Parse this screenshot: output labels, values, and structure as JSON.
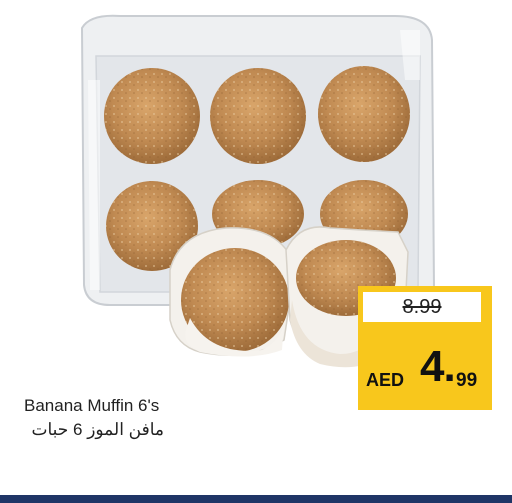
{
  "product": {
    "name_en": "Banana Muffin 6's",
    "name_ar": "مافن الموز 6 حبات"
  },
  "price": {
    "old": "8.99",
    "currency": "AED",
    "new_whole": "4.",
    "new_cents": "99"
  },
  "colors": {
    "price_box": "#f8c71c",
    "bottom_bar": "#1f3566"
  }
}
